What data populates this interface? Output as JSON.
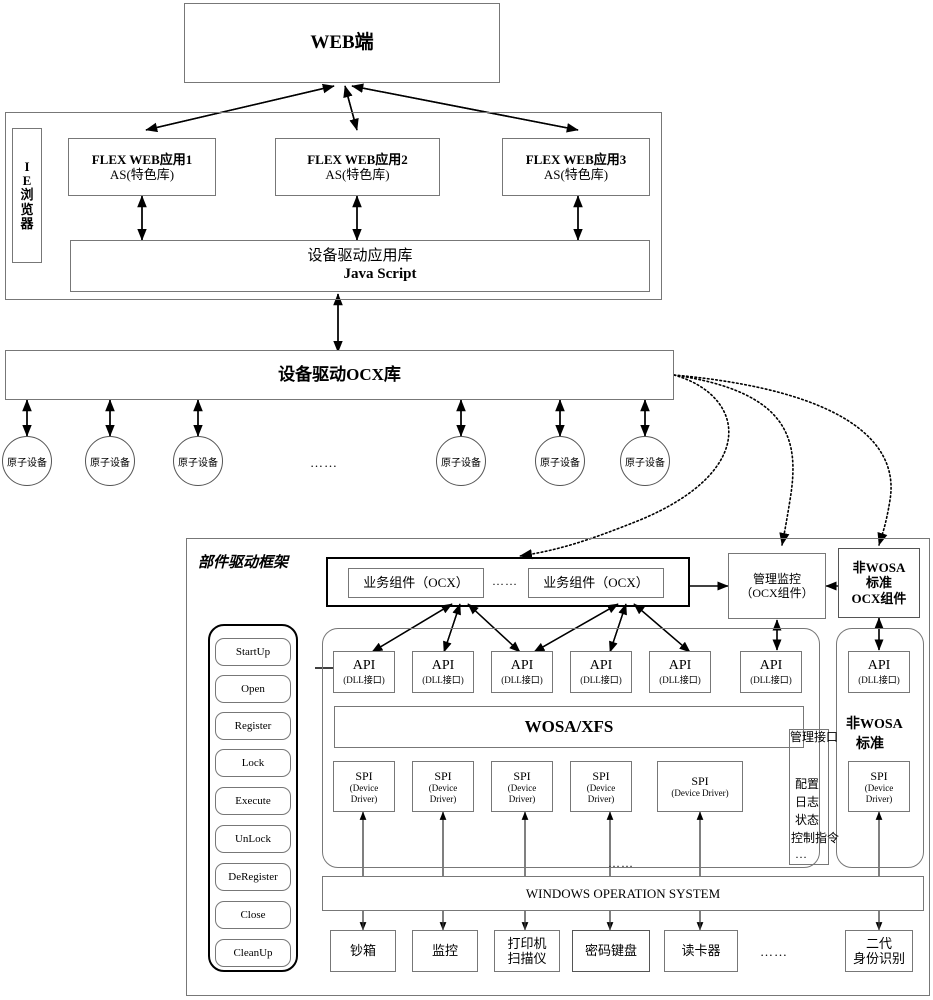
{
  "diagram": {
    "title_web": "WEB端",
    "browser_label": "IE浏览器",
    "flex_apps": [
      {
        "line1": "FLEX WEB应用1",
        "line2": "AS(特色库)"
      },
      {
        "line1": "FLEX WEB应用2",
        "line2": "AS(特色库)"
      },
      {
        "line1": "FLEX WEB应用3",
        "line2": "AS(特色库)"
      }
    ],
    "driver_app_lib": {
      "line1": "设备驱动应用库",
      "line2": "Java Script"
    },
    "ocx_lib": "设备驱动OCX库",
    "atomic_device_label": "原子设备",
    "atomic_devices_left": [
      "原子设备",
      "原子设备",
      "原子设备"
    ],
    "atomic_devices_right": [
      "原子设备",
      "原子设备",
      "原子设备"
    ],
    "atomic_ellipsis": "……",
    "framework_title": "部件驱动框架",
    "lifecycle_buttons": [
      "StartUp",
      "Open",
      "Register",
      "Lock",
      "Execute",
      "UnLock",
      "DeRegister",
      "Close",
      "CleanUp"
    ],
    "business_components": [
      {
        "label": "业务组件（OCX）"
      },
      {
        "label": "业务组件（OCX）"
      }
    ],
    "business_ellipsis": "……",
    "mgmt_monitor": {
      "line1": "管理监控",
      "line2": "（OCX组件）"
    },
    "non_wosa_ocx": {
      "line1": "非WOSA",
      "line2": "标准",
      "line3": "OCX组件"
    },
    "api_boxes": [
      {
        "line1": "API",
        "line2": "(DLL接口)"
      },
      {
        "line1": "API",
        "line2": "(DLL接口)"
      },
      {
        "line1": "API",
        "line2": "(DLL接口)"
      },
      {
        "line1": "API",
        "line2": "(DLL接口)"
      },
      {
        "line1": "API",
        "line2": "(DLL接口)"
      },
      {
        "line1": "API",
        "line2": "(DLL接口)"
      }
    ],
    "api_box_right": {
      "line1": "API",
      "line2": "(DLL接口)"
    },
    "wosa_xfs": "WOSA/XFS",
    "non_wosa_standard": {
      "line1": "非WOSA",
      "line2": "标准"
    },
    "mgmt_interface": {
      "title": "管理接口",
      "items": [
        "配置",
        "日志",
        "状态",
        "控制指令",
        "…"
      ]
    },
    "spi_boxes": [
      {
        "line1": "SPI",
        "line2": "(Device",
        "line3": "Driver)"
      },
      {
        "line1": "SPI",
        "line2": "(Device",
        "line3": "Driver)"
      },
      {
        "line1": "SPI",
        "line2": "(Device",
        "line3": "Driver)"
      },
      {
        "line1": "SPI",
        "line2": "(Device",
        "line3": "Driver)"
      },
      {
        "line1": "SPI",
        "line2": "(Device Driver)",
        "line3": ""
      }
    ],
    "spi_box_right": {
      "line1": "SPI",
      "line2": "(Device",
      "line3": "Driver)"
    },
    "spi_ellipsis": "……",
    "windows_os": "WINDOWS OPERATION SYSTEM",
    "devices": [
      {
        "line1": "钞箱",
        "line2": ""
      },
      {
        "line1": "监控",
        "line2": ""
      },
      {
        "line1": "打印机",
        "line2": "扫描仪"
      },
      {
        "line1": "密码键盘",
        "line2": ""
      },
      {
        "line1": "读卡器",
        "line2": ""
      }
    ],
    "device_ellipsis": "……",
    "device_last": {
      "line1": "二代",
      "line2": "身份识别"
    },
    "colors": {
      "line": "#000000",
      "box_border": "#555555",
      "background": "#ffffff"
    }
  }
}
